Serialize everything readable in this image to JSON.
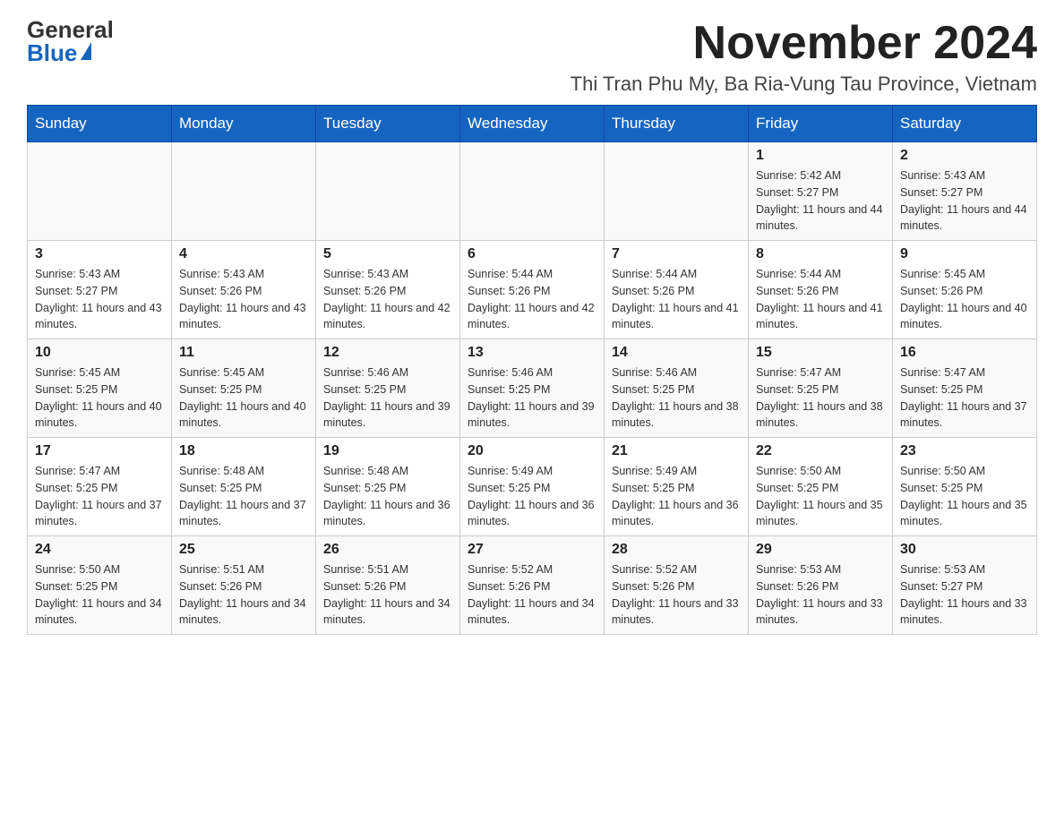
{
  "header": {
    "logo_general": "General",
    "logo_blue": "Blue",
    "month_title": "November 2024",
    "location": "Thi Tran Phu My, Ba Ria-Vung Tau Province, Vietnam"
  },
  "days_of_week": [
    "Sunday",
    "Monday",
    "Tuesday",
    "Wednesday",
    "Thursday",
    "Friday",
    "Saturday"
  ],
  "weeks": [
    [
      {
        "day": "",
        "info": ""
      },
      {
        "day": "",
        "info": ""
      },
      {
        "day": "",
        "info": ""
      },
      {
        "day": "",
        "info": ""
      },
      {
        "day": "",
        "info": ""
      },
      {
        "day": "1",
        "info": "Sunrise: 5:42 AM\nSunset: 5:27 PM\nDaylight: 11 hours and 44 minutes."
      },
      {
        "day": "2",
        "info": "Sunrise: 5:43 AM\nSunset: 5:27 PM\nDaylight: 11 hours and 44 minutes."
      }
    ],
    [
      {
        "day": "3",
        "info": "Sunrise: 5:43 AM\nSunset: 5:27 PM\nDaylight: 11 hours and 43 minutes."
      },
      {
        "day": "4",
        "info": "Sunrise: 5:43 AM\nSunset: 5:26 PM\nDaylight: 11 hours and 43 minutes."
      },
      {
        "day": "5",
        "info": "Sunrise: 5:43 AM\nSunset: 5:26 PM\nDaylight: 11 hours and 42 minutes."
      },
      {
        "day": "6",
        "info": "Sunrise: 5:44 AM\nSunset: 5:26 PM\nDaylight: 11 hours and 42 minutes."
      },
      {
        "day": "7",
        "info": "Sunrise: 5:44 AM\nSunset: 5:26 PM\nDaylight: 11 hours and 41 minutes."
      },
      {
        "day": "8",
        "info": "Sunrise: 5:44 AM\nSunset: 5:26 PM\nDaylight: 11 hours and 41 minutes."
      },
      {
        "day": "9",
        "info": "Sunrise: 5:45 AM\nSunset: 5:26 PM\nDaylight: 11 hours and 40 minutes."
      }
    ],
    [
      {
        "day": "10",
        "info": "Sunrise: 5:45 AM\nSunset: 5:25 PM\nDaylight: 11 hours and 40 minutes."
      },
      {
        "day": "11",
        "info": "Sunrise: 5:45 AM\nSunset: 5:25 PM\nDaylight: 11 hours and 40 minutes."
      },
      {
        "day": "12",
        "info": "Sunrise: 5:46 AM\nSunset: 5:25 PM\nDaylight: 11 hours and 39 minutes."
      },
      {
        "day": "13",
        "info": "Sunrise: 5:46 AM\nSunset: 5:25 PM\nDaylight: 11 hours and 39 minutes."
      },
      {
        "day": "14",
        "info": "Sunrise: 5:46 AM\nSunset: 5:25 PM\nDaylight: 11 hours and 38 minutes."
      },
      {
        "day": "15",
        "info": "Sunrise: 5:47 AM\nSunset: 5:25 PM\nDaylight: 11 hours and 38 minutes."
      },
      {
        "day": "16",
        "info": "Sunrise: 5:47 AM\nSunset: 5:25 PM\nDaylight: 11 hours and 37 minutes."
      }
    ],
    [
      {
        "day": "17",
        "info": "Sunrise: 5:47 AM\nSunset: 5:25 PM\nDaylight: 11 hours and 37 minutes."
      },
      {
        "day": "18",
        "info": "Sunrise: 5:48 AM\nSunset: 5:25 PM\nDaylight: 11 hours and 37 minutes."
      },
      {
        "day": "19",
        "info": "Sunrise: 5:48 AM\nSunset: 5:25 PM\nDaylight: 11 hours and 36 minutes."
      },
      {
        "day": "20",
        "info": "Sunrise: 5:49 AM\nSunset: 5:25 PM\nDaylight: 11 hours and 36 minutes."
      },
      {
        "day": "21",
        "info": "Sunrise: 5:49 AM\nSunset: 5:25 PM\nDaylight: 11 hours and 36 minutes."
      },
      {
        "day": "22",
        "info": "Sunrise: 5:50 AM\nSunset: 5:25 PM\nDaylight: 11 hours and 35 minutes."
      },
      {
        "day": "23",
        "info": "Sunrise: 5:50 AM\nSunset: 5:25 PM\nDaylight: 11 hours and 35 minutes."
      }
    ],
    [
      {
        "day": "24",
        "info": "Sunrise: 5:50 AM\nSunset: 5:25 PM\nDaylight: 11 hours and 34 minutes."
      },
      {
        "day": "25",
        "info": "Sunrise: 5:51 AM\nSunset: 5:26 PM\nDaylight: 11 hours and 34 minutes."
      },
      {
        "day": "26",
        "info": "Sunrise: 5:51 AM\nSunset: 5:26 PM\nDaylight: 11 hours and 34 minutes."
      },
      {
        "day": "27",
        "info": "Sunrise: 5:52 AM\nSunset: 5:26 PM\nDaylight: 11 hours and 34 minutes."
      },
      {
        "day": "28",
        "info": "Sunrise: 5:52 AM\nSunset: 5:26 PM\nDaylight: 11 hours and 33 minutes."
      },
      {
        "day": "29",
        "info": "Sunrise: 5:53 AM\nSunset: 5:26 PM\nDaylight: 11 hours and 33 minutes."
      },
      {
        "day": "30",
        "info": "Sunrise: 5:53 AM\nSunset: 5:27 PM\nDaylight: 11 hours and 33 minutes."
      }
    ]
  ]
}
